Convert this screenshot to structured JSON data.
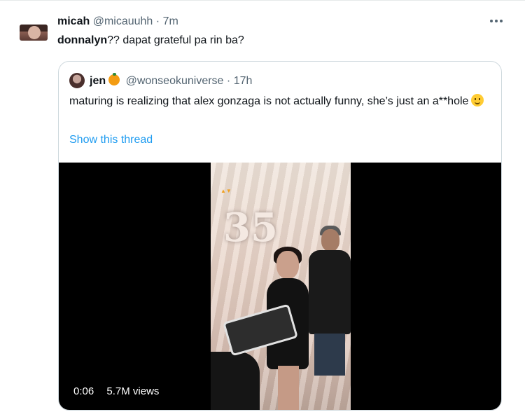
{
  "tweet": {
    "name": "micah",
    "handle": "@micauuhh",
    "separator": "·",
    "time": "7m",
    "text_bold": "donnalyn",
    "text_rest": "?? dapat grateful pa rin ba?"
  },
  "quoted": {
    "name": "jen",
    "handle": "@wonseokuniverse",
    "separator": "·",
    "time": "17h",
    "text": "maturing is realizing that alex gonzaga is not actually funny, she’s just an a**hole",
    "show_thread": "Show this thread",
    "icons": [
      "orange-emoji-icon",
      "smile-emoji-icon"
    ],
    "video": {
      "duration": "0:06",
      "views": "5.7M views",
      "balloon_text": "35",
      "progress": 0
    }
  }
}
